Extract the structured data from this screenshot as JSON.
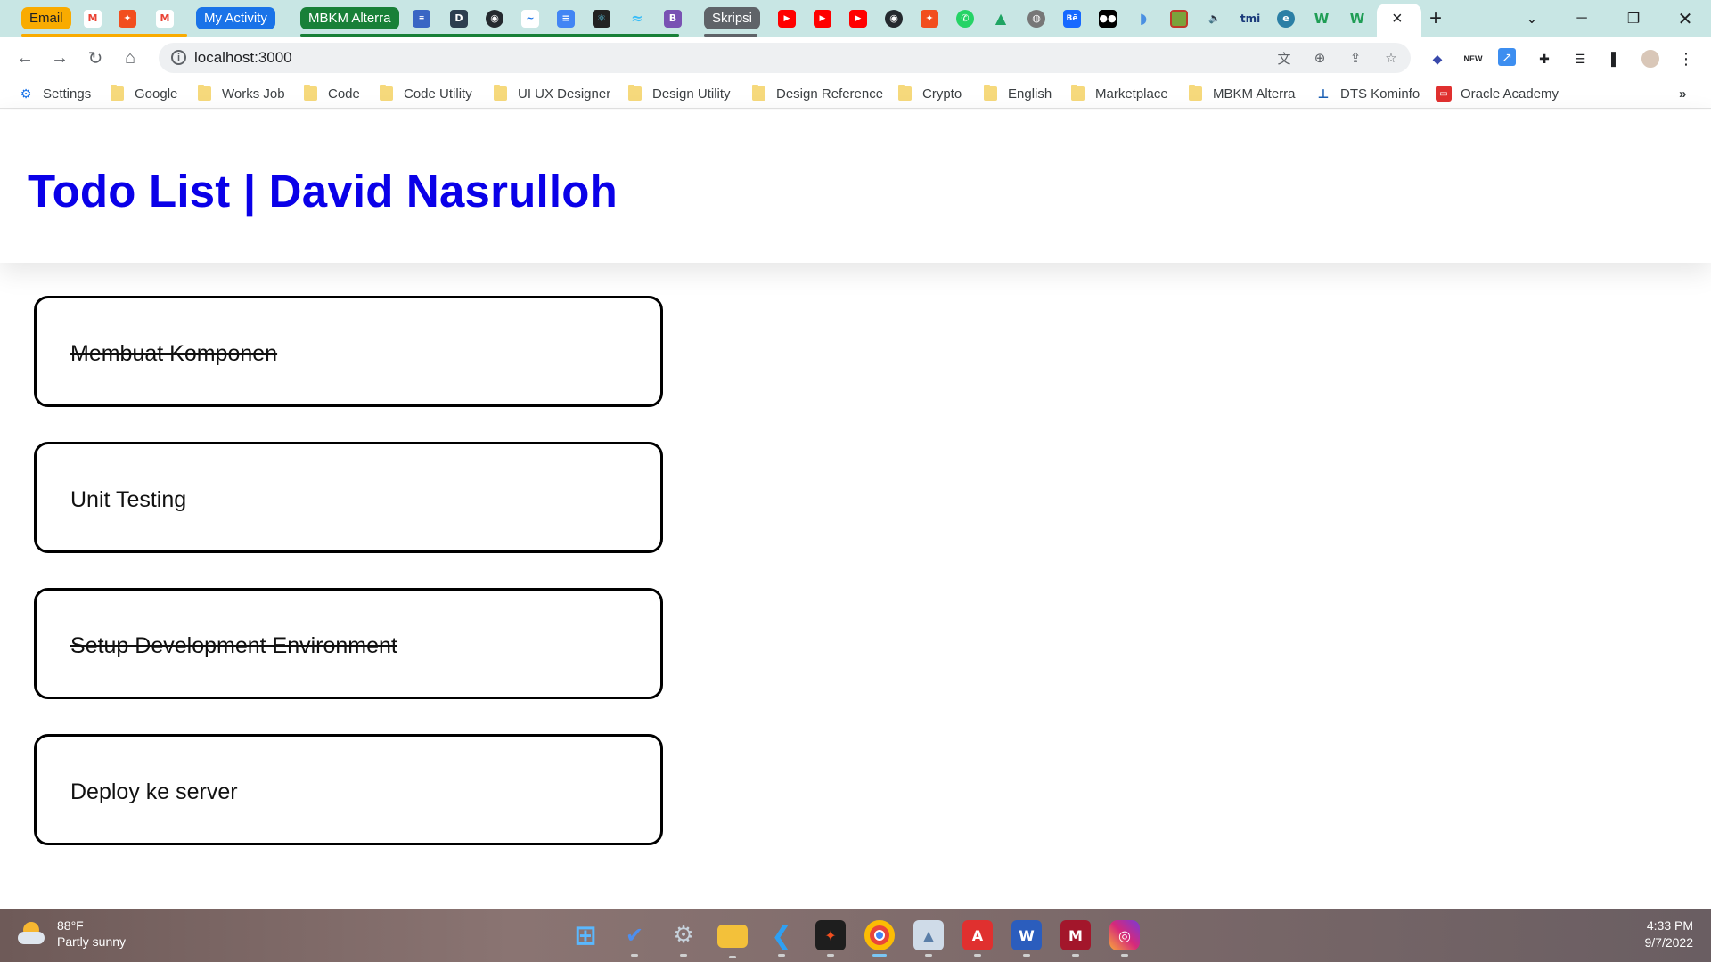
{
  "browser": {
    "tab_groups": [
      {
        "label": "Email",
        "color": "#f9ab00",
        "text_color": "#202124"
      },
      {
        "label": "My Activity",
        "color": "#1a73e8",
        "text_color": "#ffffff"
      },
      {
        "label": "MBKM Alterra",
        "color": "#188038",
        "text_color": "#ffffff"
      },
      {
        "label": "Skripsi",
        "color": "#5f6368",
        "text_color": "#ffffff"
      }
    ],
    "url": "localhost:3000"
  },
  "bookmarks": [
    {
      "label": "Settings",
      "icon": "gear-icon"
    },
    {
      "label": "Google",
      "icon": "folder-icon"
    },
    {
      "label": "Works Job",
      "icon": "folder-icon"
    },
    {
      "label": "Code",
      "icon": "folder-icon"
    },
    {
      "label": "Code Utility",
      "icon": "folder-icon"
    },
    {
      "label": "UI UX Designer",
      "icon": "folder-icon"
    },
    {
      "label": "Design Utility",
      "icon": "folder-icon"
    },
    {
      "label": "Design Reference",
      "icon": "folder-icon"
    },
    {
      "label": "Crypto",
      "icon": "folder-icon"
    },
    {
      "label": "English",
      "icon": "folder-icon"
    },
    {
      "label": "Marketplace",
      "icon": "folder-icon"
    },
    {
      "label": "MBKM Alterra",
      "icon": "folder-icon"
    },
    {
      "label": "DTS Kominfo",
      "icon": "dts-icon"
    },
    {
      "label": "Oracle Academy",
      "icon": "oracle-icon"
    }
  ],
  "page": {
    "title": "Todo List | David Nasrulloh",
    "title_color": "#0a00e8",
    "todos": [
      {
        "text": "Membuat Komponen",
        "completed": true
      },
      {
        "text": "Unit Testing",
        "completed": false
      },
      {
        "text": "Setup Development Environment",
        "completed": true
      },
      {
        "text": "Deploy ke server",
        "completed": false
      }
    ]
  },
  "taskbar": {
    "weather_temp": "88°F",
    "weather_desc": "Partly sunny",
    "time": "4:33 PM",
    "date": "9/7/2022",
    "apps": [
      {
        "name": "windows-start-icon",
        "color": "#3a9bf0",
        "glyph": "⊞"
      },
      {
        "name": "todo-app-icon",
        "color": "#2564cf",
        "glyph": "✔"
      },
      {
        "name": "settings-app-icon",
        "color": "#5a6b7b",
        "glyph": "⚙"
      },
      {
        "name": "file-explorer-icon",
        "color": "#f3c13a",
        "glyph": "▬"
      },
      {
        "name": "vscode-icon",
        "color": "#1f7ccc",
        "glyph": "❮"
      },
      {
        "name": "figma-icon",
        "color": "#1e1e1e",
        "glyph": "◆"
      },
      {
        "name": "chrome-icon",
        "color": "#e9453a",
        "glyph": "●"
      },
      {
        "name": "photos-icon",
        "color": "#9fb3c8",
        "glyph": "▲"
      },
      {
        "name": "acrobat-icon",
        "color": "#e0302f",
        "glyph": "A"
      },
      {
        "name": "word-icon",
        "color": "#2b5dbd",
        "glyph": "W"
      },
      {
        "name": "mendeley-icon",
        "color": "#a3162b",
        "glyph": "M"
      },
      {
        "name": "instagram-icon",
        "color": "#d6297a",
        "glyph": "◎"
      }
    ]
  }
}
